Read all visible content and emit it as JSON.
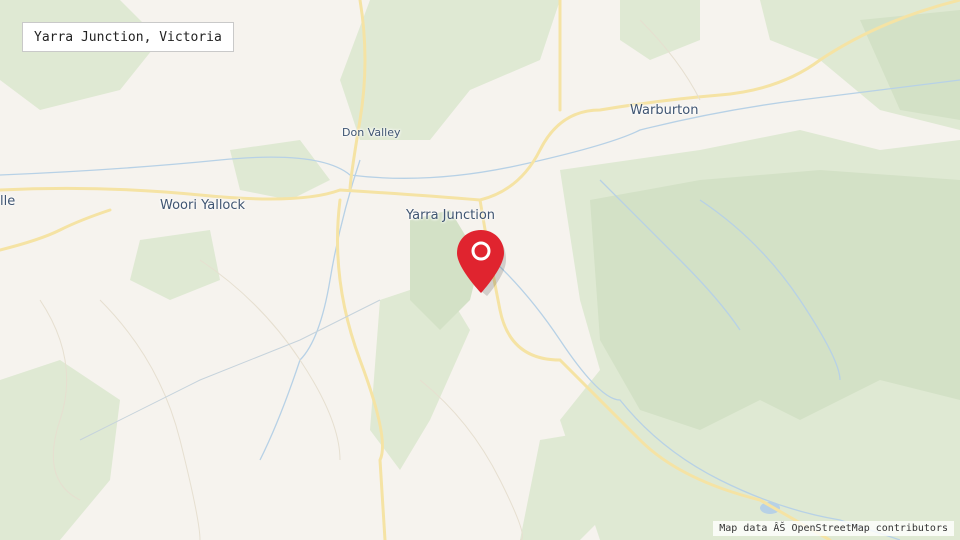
{
  "search": {
    "query": "Yarra Junction, Victoria"
  },
  "places": [
    {
      "name": "Warburton"
    },
    {
      "name": "Don Valley"
    },
    {
      "name": "Yarra Junction"
    },
    {
      "name": "Woori Yallock"
    },
    {
      "name": "lle"
    }
  ],
  "marker": {
    "icon": "map-pin-icon",
    "color": "#e0242f"
  },
  "attribution": {
    "text": "Map data ÂŠ OpenStreetMap contributors"
  },
  "colors": {
    "land": "#f6f3ee",
    "forest": "#dfe9d3",
    "forest_dark": "#d3e1c6",
    "road": "#f5e3a4",
    "water": "#b7d1e6"
  }
}
